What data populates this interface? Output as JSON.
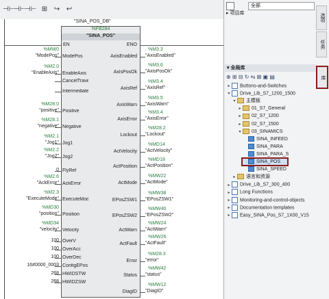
{
  "toolbar": {
    "icons": [
      "rung-open-icon",
      "rung-close-icon",
      "rung-contact-icon",
      "function-box-icon",
      "jump-icon",
      "return-icon"
    ]
  },
  "block": {
    "db_name": "\"SINA_POS_DB\"",
    "instance": "%FB284",
    "name": "\"SINA_POS\"",
    "en": "EN",
    "eno": "ENO"
  },
  "inputs": [
    {
      "addr": "%MW0",
      "tag": "\"ModePos\"",
      "pin": "ModePos"
    },
    {
      "addr": "%M2.0",
      "tag": "\"EnableAxis\"",
      "pin": "EnableAxis"
    },
    {
      "addr": "",
      "tag": "",
      "pin": "CancelTraversing"
    },
    {
      "addr": "",
      "tag": "",
      "pin": "IntermediateStop"
    },
    {
      "addr": "%M28.0",
      "tag": "\"positive\"",
      "pin": "Positive"
    },
    {
      "addr": "%M28.1",
      "tag": "\"negative\"",
      "pin": "Negative"
    },
    {
      "addr": "%M2.1",
      "tag": "\"Jog1\"",
      "pin": "Jog1"
    },
    {
      "addr": "%M2.2",
      "tag": "\"Jog2\"",
      "pin": "Jog2"
    },
    {
      "addr": "",
      "tag": "0",
      "pin": "FlyRef"
    },
    {
      "addr": "%M2.6",
      "tag": "\"AckError\"",
      "pin": "AckError"
    },
    {
      "addr": "%M2.3",
      "tag": "\"ExecuteMode\"",
      "pin": "ExecuteMode"
    },
    {
      "addr": "%MD30",
      "tag": "\"position\"",
      "pin": "Position"
    },
    {
      "addr": "%MD34",
      "tag": "\"velocity\"",
      "pin": "Velocity"
    },
    {
      "addr": "",
      "tag": "100",
      "pin": "OverV"
    },
    {
      "addr": "",
      "tag": "100",
      "pin": "OverAcc"
    },
    {
      "addr": "",
      "tag": "100",
      "pin": "OverDec"
    },
    {
      "addr": "",
      "tag": "16#0000_0003",
      "pin": "ConfigEPos"
    },
    {
      "addr": "",
      "tag": "268",
      "pin": "HWIDSTW"
    },
    {
      "addr": "",
      "tag": "268",
      "pin": "HWIDZSW"
    }
  ],
  "outputs": [
    {
      "addr": "%M3.3",
      "tag": "\"AxisEnabled\"",
      "pin": "AxisEnabled"
    },
    {
      "addr": "%M3.6",
      "tag": "\"AxisPosOk\"",
      "pin": "AxisPosOk"
    },
    {
      "addr": "%M3.4",
      "tag": "\"AxisRef\"",
      "pin": "AxisRef"
    },
    {
      "addr": "%M3.5",
      "tag": "\"AxisWarn\"",
      "pin": "AxisWarn"
    },
    {
      "addr": "%M3.4",
      "tag": "\"AxisError\"",
      "pin": "AxisError"
    },
    {
      "addr": "%M28.2",
      "tag": "\"Lockout\"",
      "pin": "Lockout"
    },
    {
      "addr": "%MD14",
      "tag": "\"ActVelocity\"",
      "pin": "ActVelocity"
    },
    {
      "addr": "%MD18",
      "tag": "\"ActPosition\"",
      "pin": "ActPosition"
    },
    {
      "addr": "%MW22",
      "tag": "\"ActMode\"",
      "pin": "ActMode"
    },
    {
      "addr": "%MW38",
      "tag": "\"EPosZSW1\"",
      "pin": "EPosZSW1"
    },
    {
      "addr": "%MW40",
      "tag": "\"EPosZSW2\"",
      "pin": "EPosZSW2"
    },
    {
      "addr": "%MW24",
      "tag": "\"ActWarn\"",
      "pin": "ActWarn"
    },
    {
      "addr": "%MW26",
      "tag": "\"ActFault\"",
      "pin": "ActFault"
    },
    {
      "addr": "%M28.3",
      "tag": "\"error\"",
      "pin": "Error"
    },
    {
      "addr": "%MW42",
      "tag": "\"status\"",
      "pin": "Status"
    },
    {
      "addr": "%MW12",
      "tag": "\"DiagID\"",
      "pin": "DiagID"
    }
  ],
  "panel": {
    "filter_value": "全部",
    "project_library": "项目库",
    "global_library": "全局库",
    "side_tabs": [
      "选项",
      "任务",
      "库"
    ],
    "tree": [
      {
        "level": 0,
        "type": "lib",
        "label": "Buttons-and-Switches"
      },
      {
        "level": 0,
        "type": "lib",
        "label": "Drive_Lib_S7_1200_1500",
        "open": true
      },
      {
        "level": 1,
        "type": "folder",
        "label": "主模板",
        "open": true
      },
      {
        "level": 2,
        "type": "folder",
        "label": "01_S7_General"
      },
      {
        "level": 2,
        "type": "folder",
        "label": "02_S7_1200"
      },
      {
        "level": 2,
        "type": "folder",
        "label": "02_S7_1500"
      },
      {
        "level": 2,
        "type": "folder",
        "label": "03_SINAMICS",
        "open": true
      },
      {
        "level": 3,
        "type": "block",
        "label": "SINA_INFEED"
      },
      {
        "level": 3,
        "type": "block",
        "label": "SINA_PARA"
      },
      {
        "level": 3,
        "type": "block",
        "label": "SINA_PARA_S"
      },
      {
        "level": 3,
        "type": "block",
        "label": "SINA_POS",
        "selected": true
      },
      {
        "level": 3,
        "type": "block",
        "label": "SINA_SPEED"
      },
      {
        "level": 1,
        "type": "folder",
        "label": "语言和资源"
      },
      {
        "level": 0,
        "type": "lib",
        "label": "Drive_Lib_S7_300_400"
      },
      {
        "level": 0,
        "type": "lib",
        "label": "Long Functions"
      },
      {
        "level": 0,
        "type": "lib",
        "label": "Monitoring-and-control-objects"
      },
      {
        "level": 0,
        "type": "lib",
        "label": "Documentation templates"
      },
      {
        "level": 0,
        "type": "lib",
        "label": "Easy_SINA_Pos_S7_1X00_V15"
      }
    ]
  },
  "colors": {
    "highlight": "#8b1a1a",
    "address": "#2a7d3f",
    "selection": "#cfe0f5"
  }
}
